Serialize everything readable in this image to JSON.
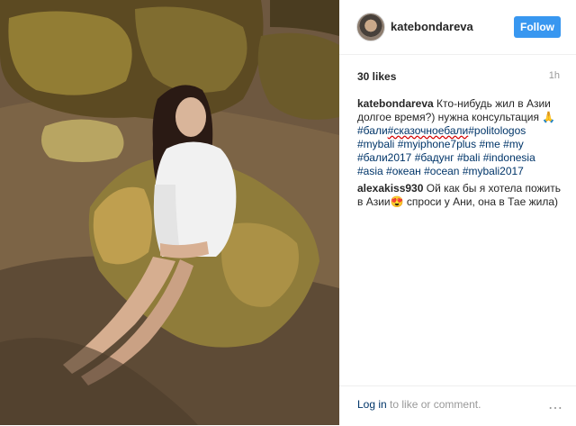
{
  "post": {
    "username": "katebondareva",
    "follow_label": "Follow",
    "likes": "30 likes",
    "time": "1h"
  },
  "comments": {
    "caption_user": "katebondareva",
    "caption_text": "Кто-нибудь жил в Азии долгое время?) нужна консультация 🙏",
    "caption_tags": [
      "#бали",
      "#сказочноебали",
      "#politologos",
      "#mybali",
      "#myiphone7plus",
      "#me",
      "#my",
      "#бали2017",
      "#бадунг",
      "#bali",
      "#indonesia",
      "#asia",
      "#океан",
      "#ocean",
      "#mybali2017"
    ],
    "reply_user": "alexakiss930",
    "reply_text": "Ой как бы я хотела пожить в Азии😍 спроси у Ани, она в Тае жила)"
  },
  "footer": {
    "login_link": "Log in",
    "login_rest": " to like or comment.",
    "more_icon": "⋯"
  },
  "icons": {
    "more": "more-options-icon"
  }
}
